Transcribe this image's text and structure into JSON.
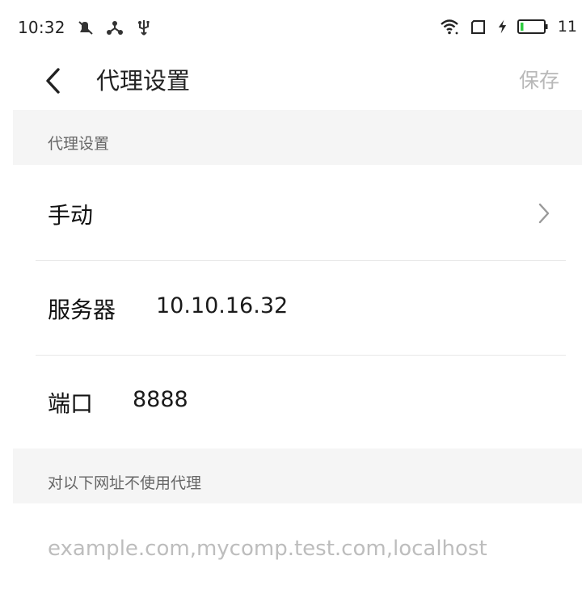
{
  "status_bar": {
    "time": "10:32",
    "battery_level": "11",
    "icons": [
      "silent-icon",
      "network-hub-icon",
      "usb-icon",
      "wifi-icon",
      "screen-rotate-icon",
      "charging-icon",
      "battery-icon"
    ]
  },
  "header": {
    "title": "代理设置",
    "save_label": "保存",
    "back_icon": "chevron-left-icon"
  },
  "sections": {
    "proxy": {
      "header": "代理设置",
      "mode_label": "手动",
      "server_label": "服务器",
      "server_value": "10.10.16.32",
      "port_label": "端口",
      "port_value": "8888"
    },
    "bypass": {
      "header": "对以下网址不使用代理",
      "placeholder": "example.com,mycomp.test.com,localhost"
    }
  },
  "colors": {
    "section_bg": "#f5f5f5",
    "divider": "#e8e8e8",
    "disabled_text": "#b8b8b8",
    "battery_fill": "#2ecc40"
  }
}
